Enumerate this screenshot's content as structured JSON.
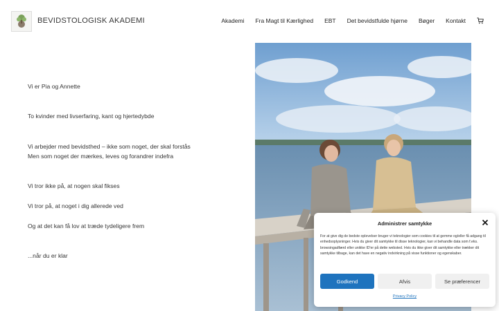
{
  "header": {
    "brand": "BEVIDSTOLOGISK AKADEMI",
    "nav": [
      "Akademi",
      "Fra Magt til Kærlighed",
      "EBT",
      "Det bevidstfulde hjørne",
      "Bøger",
      "Kontakt"
    ],
    "cart_icon": "cart-icon"
  },
  "content": {
    "lines": [
      "Vi er Pia og Annette",
      "To kvinder med livserfaring, kant og hjertedybde",
      "Vi arbejder med bevidsthed – ikke som noget, der skal forstås",
      "Men som noget der mærkes, leves og forandrer indefra",
      "Vi tror ikke på, at nogen skal fikses",
      "Vi tror på, at noget i dig allerede ved",
      "Og at det kan få lov at træde tydeligere frem",
      "...når du er klar"
    ]
  },
  "consent": {
    "title": "Administrer samtykke",
    "text": "For at give dig de bedste oplevelser bruger vi teknologier som cookies til at gemme og/eller få adgang til enhedsoplysninger. Hvis du giver dit samtykke til disse teknologier, kan vi behandle data som f.eks. browsingadfærd eller unikke ID'er på dette websted. Hvis du ikke giver dit samtykke eller trækker dit samtykke tilbage, kan det have en negativ indvirkning på visse funktioner og egenskaber.",
    "accept": "Godkend",
    "deny": "Afvis",
    "preferences": "Se præferencer",
    "policy": "Privacy Policy"
  },
  "colors": {
    "accent": "#1e73be"
  }
}
